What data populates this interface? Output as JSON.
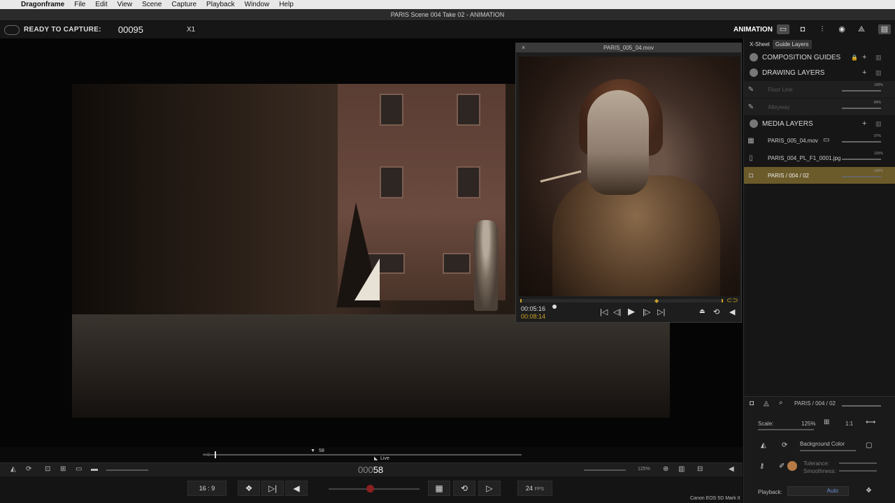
{
  "menubar": {
    "app": "Dragonframe",
    "items": [
      "File",
      "Edit",
      "View",
      "Scene",
      "Capture",
      "Playback",
      "Window",
      "Help"
    ]
  },
  "window": {
    "title": "PARIS  Scene 004  Take 02 - ANIMATION"
  },
  "capture": {
    "status": "READY TO CAPTURE:",
    "frame": "00095",
    "multiplier": "X1",
    "mode": "ANIMATION"
  },
  "movie_panel": {
    "title": "PARIS_005_04.mov",
    "close": "×",
    "time_current": "00:05:16",
    "time_total": "00:08:14"
  },
  "right_panel": {
    "tabs": [
      "X-Sheet",
      "Guide Layers"
    ],
    "sections": {
      "composition": "COMPOSITION GUIDES",
      "drawing": "DRAWING LAYERS",
      "media": "MEDIA LAYERS"
    },
    "drawing_layers": [
      {
        "name": "Floor Line",
        "pct": "100%"
      },
      {
        "name": "Alleyway",
        "pct": "84%"
      }
    ],
    "media_layers": [
      {
        "name": "PARIS_005_04.mov",
        "pct": "97%"
      },
      {
        "name": "PARIS_004_PL_F1_0001.jpg",
        "pct": "100%"
      },
      {
        "name": "PARIS / 004 / 02",
        "pct": "100%"
      }
    ],
    "selected_layer": "PARIS / 004 / 02",
    "scale_label": "Scale:",
    "scale_value": "125%",
    "one_to_one": "1:1",
    "background_color": "Background Color",
    "tolerance": "Tolerance:",
    "smoothness": "Smoothness:",
    "playback_label": "Playback:",
    "playback_value": "Auto"
  },
  "timeline": {
    "marker_58": "58",
    "live": "Live",
    "start_left": "< 0"
  },
  "viewer_toolbar": {
    "frame_prefix": "000",
    "frame_current": "58",
    "zoom": "125%"
  },
  "transport": {
    "aspect": "16 : 9",
    "fps": "24",
    "fps_unit": "FPS",
    "camera": "Canon EOS 5D Mark II"
  }
}
